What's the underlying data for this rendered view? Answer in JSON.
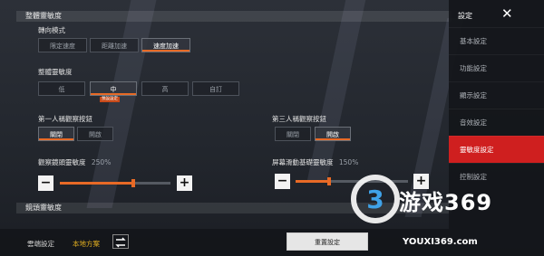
{
  "sections": {
    "overall": "整體靈敏度",
    "scope": "鏡頭靈敏度"
  },
  "turn_mode": {
    "label": "轉向模式",
    "options": [
      "限定速度",
      "距離加速",
      "速度加速"
    ],
    "selected": "速度加速"
  },
  "overall_sensitivity": {
    "label": "整體靈敏度",
    "options": [
      "低",
      "中",
      "高",
      "自訂"
    ],
    "selected": "中",
    "badge": "預設設定"
  },
  "first_person_button": {
    "label": "第一人稱觀察按鈕",
    "options": [
      "關閉",
      "開啟"
    ],
    "selected": "關閉"
  },
  "third_person_button": {
    "label": "第三人稱觀察按鈕",
    "options": [
      "關閉",
      "開啟"
    ],
    "selected": "開啟"
  },
  "camera_slider": {
    "label": "觀察鏡頭靈敏度",
    "value_text": "250%",
    "fill_fraction": 0.66,
    "minus": "−",
    "plus": "+"
  },
  "screen_slider": {
    "label": "屏幕滑動基礎靈敏度",
    "value_text": "150%",
    "fill_fraction": 0.3,
    "minus": "−",
    "plus": "+"
  },
  "footer": {
    "cloud_label": "雲端設定",
    "scheme_label": "本地方案",
    "reset_label": "重置設定"
  },
  "sidebar": {
    "title": "設定",
    "close": "✕",
    "items": [
      "基本設定",
      "功能設定",
      "顯示設定",
      "音效設定",
      "靈敏度設定",
      "控制設定"
    ],
    "active": "靈敏度設定"
  },
  "watermark": {
    "text": "游戏369",
    "url": "YOUXI369.com"
  },
  "colors": {
    "accent": "#e86a26",
    "sidebar_active": "#cf1f1f"
  }
}
